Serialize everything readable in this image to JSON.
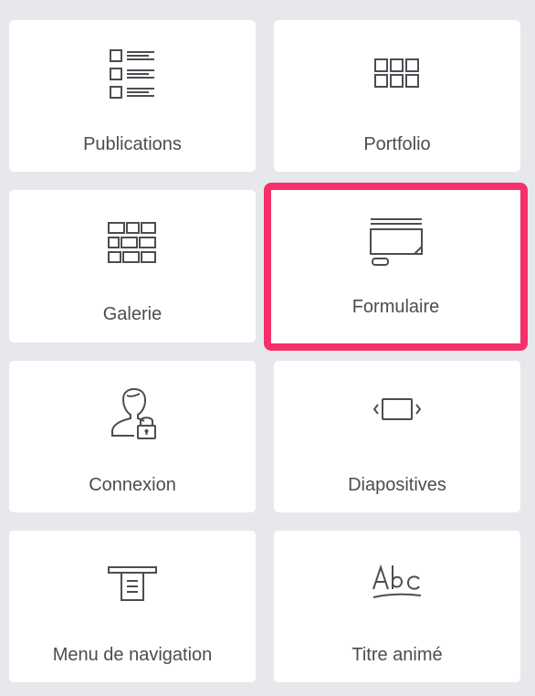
{
  "widgets": [
    {
      "id": "publications",
      "label": "Publications",
      "icon": "posts-list-icon",
      "selected": false
    },
    {
      "id": "portfolio",
      "label": "Portfolio",
      "icon": "portfolio-grid-icon",
      "selected": false
    },
    {
      "id": "galerie",
      "label": "Galerie",
      "icon": "gallery-icon",
      "selected": false
    },
    {
      "id": "formulaire",
      "label": "Formulaire",
      "icon": "form-icon",
      "selected": true
    },
    {
      "id": "connexion",
      "label": "Connexion",
      "icon": "login-user-lock-icon",
      "selected": false
    },
    {
      "id": "diapositives",
      "label": "Diapositives",
      "icon": "slides-icon",
      "selected": false
    },
    {
      "id": "menu",
      "label": "Menu de navigation",
      "icon": "nav-menu-icon",
      "selected": false
    },
    {
      "id": "titre",
      "label": "Titre animé",
      "icon": "animated-headline-icon",
      "selected": false
    }
  ],
  "colors": {
    "background": "#e6e8eb",
    "tile": "#ffffff",
    "icon": "#4a4e53",
    "label": "#494d52",
    "highlight": "#f6306a"
  }
}
